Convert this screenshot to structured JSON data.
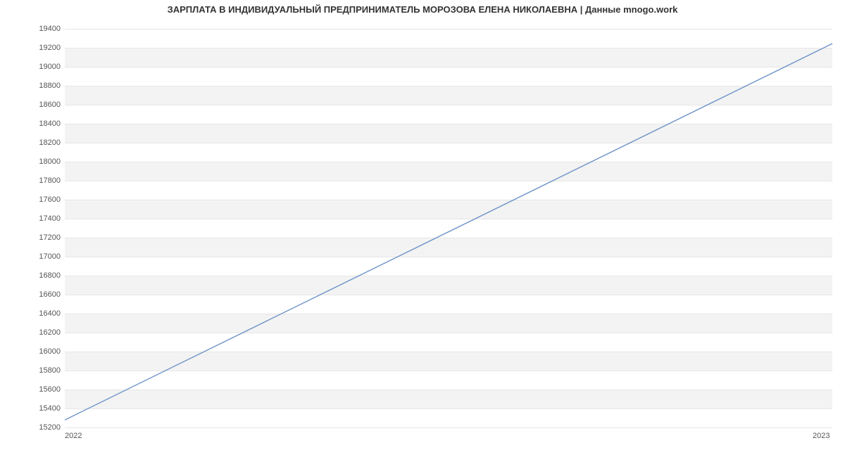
{
  "chart_data": {
    "type": "line",
    "title": "ЗАРПЛАТА В ИНДИВИДУАЛЬНЫЙ ПРЕДПРИНИМАТЕЛЬ МОРОЗОВА ЕЛЕНА НИКОЛАЕВНА | Данные mnogo.work",
    "x": [
      2022,
      2023
    ],
    "values": [
      15279,
      19242
    ],
    "xlabel": "",
    "ylabel": "",
    "x_ticks": [
      2022,
      2023
    ],
    "y_ticks": [
      15200,
      15400,
      15600,
      15800,
      16000,
      16200,
      16400,
      16600,
      16800,
      17000,
      17200,
      17400,
      17600,
      17800,
      18000,
      18200,
      18400,
      18600,
      18800,
      19000,
      19200,
      19400
    ],
    "ylim": [
      15200,
      19420
    ],
    "xlim": [
      2022,
      2023
    ],
    "grid": true,
    "line_color": "#6f94c9"
  }
}
